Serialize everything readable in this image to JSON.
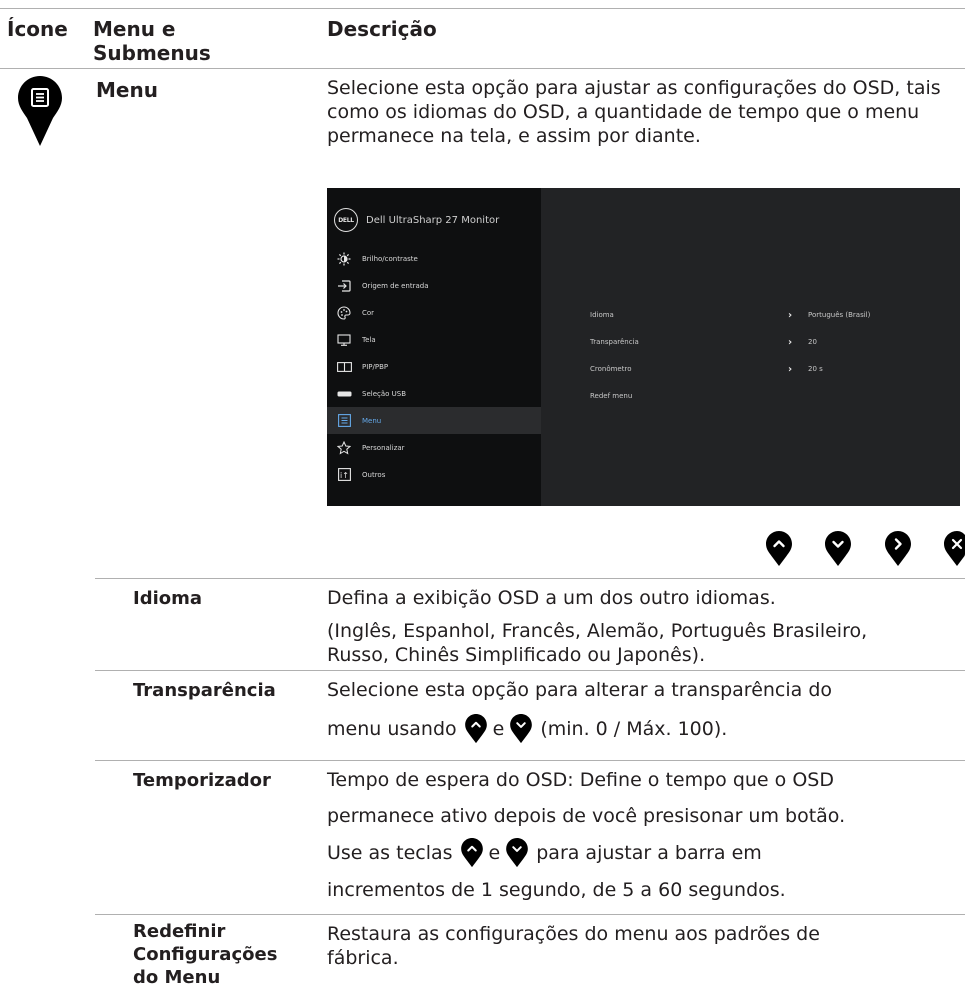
{
  "header": {
    "icon_col": "Ícone",
    "menu_col_line1": "Menu e",
    "menu_col_line2": "Submenus",
    "desc_col": "Descrição"
  },
  "menu_section": {
    "icon": "menu-pin-icon",
    "title": "Menu",
    "description": "Selecione esta opção para ajustar as configurações do OSD, tais como os idiomas do OSD, a quantidade de tempo que o menu permanece na tela, e assim por diante."
  },
  "osd": {
    "logo": "DELL",
    "monitor_name": "Dell UltraSharp 27 Monitor",
    "items": [
      {
        "icon": "brightness-icon",
        "label": "Brilho/contraste"
      },
      {
        "icon": "input-source-icon",
        "label": "Origem de entrada"
      },
      {
        "icon": "color-palette-icon",
        "label": "Cor"
      },
      {
        "icon": "display-icon",
        "label": "Tela"
      },
      {
        "icon": "pip-pbp-icon",
        "label": "PIP/PBP"
      },
      {
        "icon": "usb-icon",
        "label": "Seleção USB"
      },
      {
        "icon": "menu-icon",
        "label": "Menu",
        "selected": true
      },
      {
        "icon": "star-icon",
        "label": "Personalizar"
      },
      {
        "icon": "others-icon",
        "label": "Outros"
      }
    ],
    "rows": [
      {
        "label": "Idioma",
        "value": "Português (Brasil)"
      },
      {
        "label": "Transparência",
        "value": "20"
      },
      {
        "label": "Cronômetro",
        "value": "20 s"
      },
      {
        "label": "Redef menu",
        "value": ""
      }
    ]
  },
  "buttons": [
    "up-arrow-icon",
    "down-arrow-icon",
    "right-arrow-icon",
    "close-icon"
  ],
  "submenus": [
    {
      "title": "Idioma",
      "lines": [
        "Defina a exibição OSD a um dos outro idiomas.",
        "(Inglês, Espanhol, Francês, Alemão, Português Brasileiro,",
        "Russo, Chinês Simplificado ou Japonês)."
      ]
    },
    {
      "title": "Transparência",
      "line1": "Selecione esta opção para alterar a transparência do",
      "line2_a": "menu usando",
      "line2_b": "e",
      "line2_c": "(min. 0 / Máx. 100)."
    },
    {
      "title": "Temporizador",
      "line1": "Tempo de espera do OSD: Define o tempo que o OSD",
      "line2": "permanece ativo depois de você presisonar um botão.",
      "line3_a": "Use as teclas",
      "line3_b": "e",
      "line3_c": "para ajustar a barra em",
      "line4": "incrementos de 1 segundo, de 5 a 60 segundos."
    },
    {
      "title_lines": [
        "Redefinir",
        "Configurações",
        "do Menu"
      ],
      "lines": [
        "Restaura as configurações do menu aos padrões de",
        "fábrica."
      ]
    }
  ],
  "colors": {
    "osd_bg": "#222325",
    "osd_left": "#0e0f10",
    "osd_selected_text": "#64a8e8",
    "pin": "#000000"
  }
}
